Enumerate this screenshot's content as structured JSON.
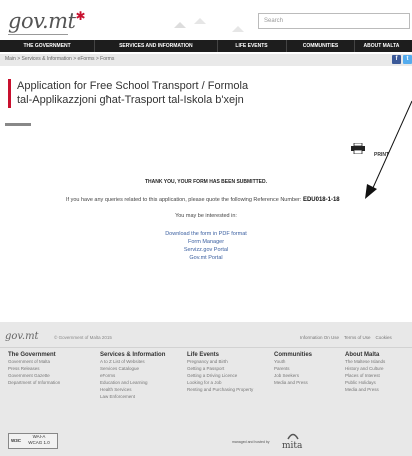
{
  "header": {
    "logo_text": "gov.mt",
    "search_placeholder": "Search"
  },
  "nav": [
    "THE GOVERNMENT",
    "SERVICES AND INFORMATION",
    "LIFE EVENTS",
    "COMMUNITIES",
    "ABOUT MALTA"
  ],
  "breadcrumb": "Main > Services & Information > eForms > Forms",
  "social": [
    "f",
    "t"
  ],
  "page": {
    "title_line1": "Application for Free School Transport / Formola",
    "title_line2": "tal-Applikazzjoni għat-Trasport tal-Iskola b'xejn",
    "print_label": "PRINT"
  },
  "message": {
    "thanks": "THANK YOU, YOUR FORM HAS BEEN SUBMITTED.",
    "query_text": "If you have any queries related to this application, please quote the following Reference Number:",
    "reference_number": "EDU018-1-18",
    "interested": "You may be interested in:"
  },
  "links": [
    "Download the form in PDF format",
    "Form Manager",
    "Servizz.gov Portal",
    "Gov.mt Portal"
  ],
  "footer": {
    "logo_text": "gov.mt",
    "copyright": "© Government of Malta 2015",
    "links": [
      "Information On Use",
      "Terms of Use",
      "Cookies"
    ],
    "columns": [
      {
        "title": "The Government",
        "items": [
          "Government of Malta",
          "Press Releases",
          "Government Gazette",
          "Department of Information"
        ]
      },
      {
        "title": "Services & Information",
        "items": [
          "A to Z List of Websites",
          "Services Catalogue",
          "eForms",
          "Education and Learning",
          "Health Services",
          "Law Enforcement"
        ]
      },
      {
        "title": "Life Events",
        "items": [
          "Pregnancy and Birth",
          "Getting a Passport",
          "Getting a Driving Licence",
          "Looking for a Job",
          "Renting and Purchasing Property"
        ]
      },
      {
        "title": "Communities",
        "items": [
          "Youth",
          "Parents",
          "Job Seekers",
          "Media and Press"
        ]
      },
      {
        "title": "About Malta",
        "items": [
          "The Maltese Islands",
          "History and Culture",
          "Places of Interest",
          "Public Holidays",
          "Media and Press"
        ]
      }
    ],
    "badge_line1": "WAI-A",
    "badge_line2": "WCAG 1.0",
    "badge_prefix": "W3C",
    "mita_text": "managed and hosted by",
    "mita_logo": "mita"
  },
  "colors": {
    "accent": "#c8102e",
    "nav_bg": "#1d1d1d",
    "link": "#3a5fa0"
  }
}
